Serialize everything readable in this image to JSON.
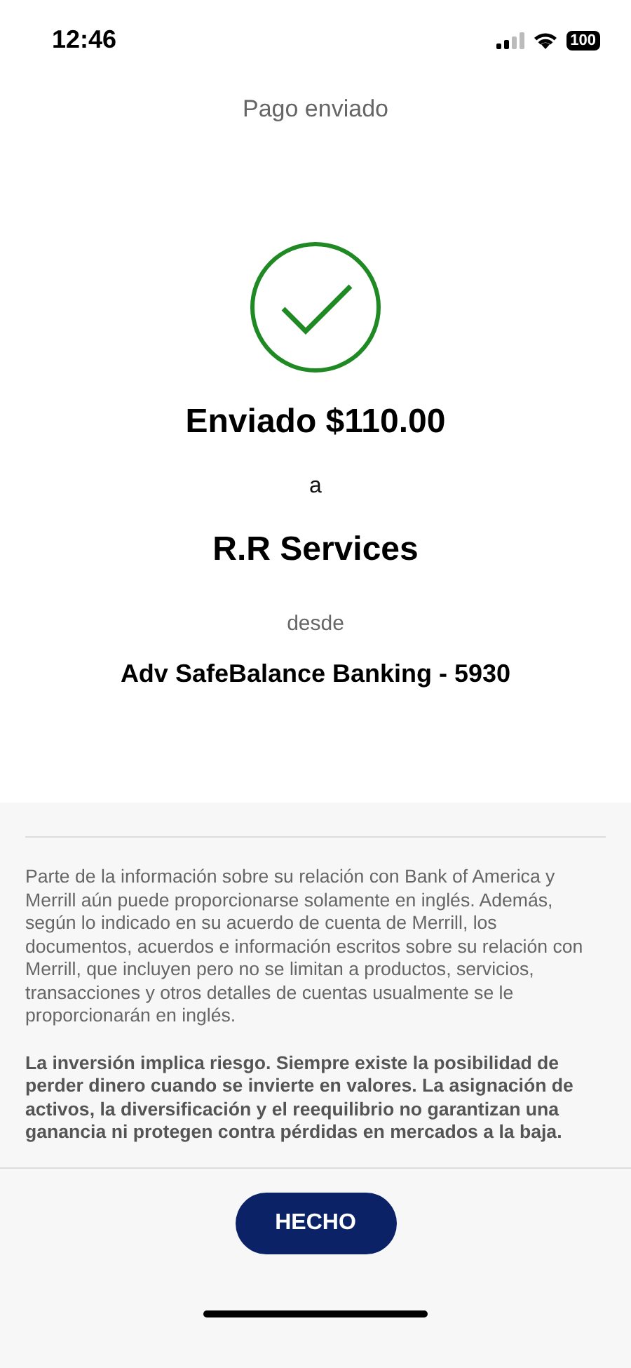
{
  "status_bar": {
    "time": "12:46",
    "battery": "100"
  },
  "header": {
    "title": "Pago enviado"
  },
  "confirmation": {
    "amount_text": "Enviado $110.00",
    "connector": "a",
    "recipient": "R.R Services",
    "from_label": "desde",
    "account": "Adv SafeBalance Banking - 5930"
  },
  "disclaimers": [
    {
      "kind": "normal",
      "text": "Parte de la información sobre su relación con Bank of America y Merrill aún puede proporcionarse solamente en inglés. Además, según lo indicado en su acuerdo de cuenta de Merrill, los documentos, acuerdos e información escritos sobre su relación con Merrill, que incluyen pero no se limitan a productos, servicios, transacciones y otros detalles de cuentas usualmente se le proporcionarán en inglés."
    },
    {
      "kind": "bold",
      "text": "La inversión implica riesgo. Siempre existe la posibilidad de perder dinero cuando se invierte en valores. La asignación de activos, la diversificación y el reequilibrio no garantizan una ganancia ni protegen contra pérdidas en mercados a la baja."
    }
  ],
  "done_button": {
    "label": "HECHO"
  }
}
